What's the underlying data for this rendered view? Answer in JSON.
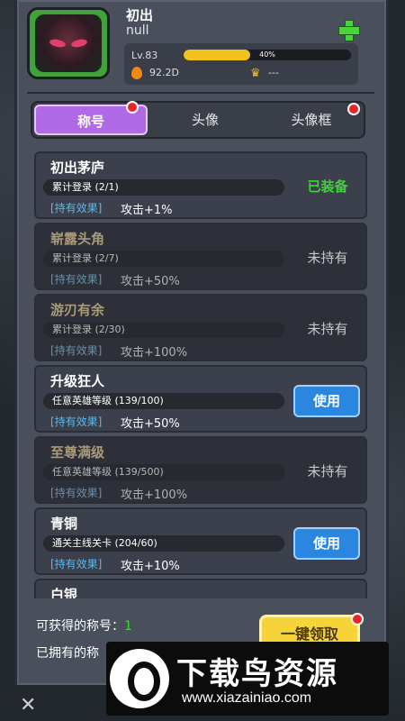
{
  "header": {
    "player_name": "初出",
    "guild": "null",
    "level": "Lv.83",
    "xp_percent": 40,
    "xp_text": "40%",
    "power": "92.2D",
    "rank": "---"
  },
  "tabs": [
    {
      "label": "称号",
      "active": true,
      "badge": true
    },
    {
      "label": "头像",
      "active": false,
      "badge": false
    },
    {
      "label": "头像框",
      "active": false,
      "badge": true
    }
  ],
  "titles": [
    {
      "name": "初出茅庐",
      "condition": "累计登录 (2/1)",
      "effect_tag": "[持有效果]",
      "effect": "攻击+1%",
      "status": "已装备",
      "state": "equipped"
    },
    {
      "name": "崭露头角",
      "condition": "累计登录 (2/7)",
      "effect_tag": "[持有效果]",
      "effect": "攻击+50%",
      "status": "未持有",
      "state": "locked"
    },
    {
      "name": "游刃有余",
      "condition": "累计登录 (2/30)",
      "effect_tag": "[持有效果]",
      "effect": "攻击+100%",
      "status": "未持有",
      "state": "locked"
    },
    {
      "name": "升级狂人",
      "condition": "任意英雄等级 (139/100)",
      "effect_tag": "[持有效果]",
      "effect": "攻击+50%",
      "status": "使用",
      "state": "owned"
    },
    {
      "name": "至尊满级",
      "condition": "任意英雄等级 (139/500)",
      "effect_tag": "[持有效果]",
      "effect": "攻击+100%",
      "status": "未持有",
      "state": "locked"
    },
    {
      "name": "青铜",
      "condition": "通关主线关卡 (204/60)",
      "effect_tag": "[持有效果]",
      "effect": "攻击+10%",
      "status": "使用",
      "state": "owned"
    },
    {
      "name": "白银"
    }
  ],
  "footer": {
    "obtainable_label": "可获得的称号：",
    "obtainable_count": "1",
    "owned_label": "已拥有的称",
    "claim_button": "一键领取",
    "close_symbol": "✕"
  },
  "watermark": {
    "title": "下载鸟资源",
    "url": "www.xiazainiao.com"
  },
  "colors": {
    "equipped": "#3fd23a",
    "active_tab": "#b16ae6",
    "use_button": "#2b86e0",
    "claim_button": "#f7d33a",
    "badge": "#e8232a"
  }
}
